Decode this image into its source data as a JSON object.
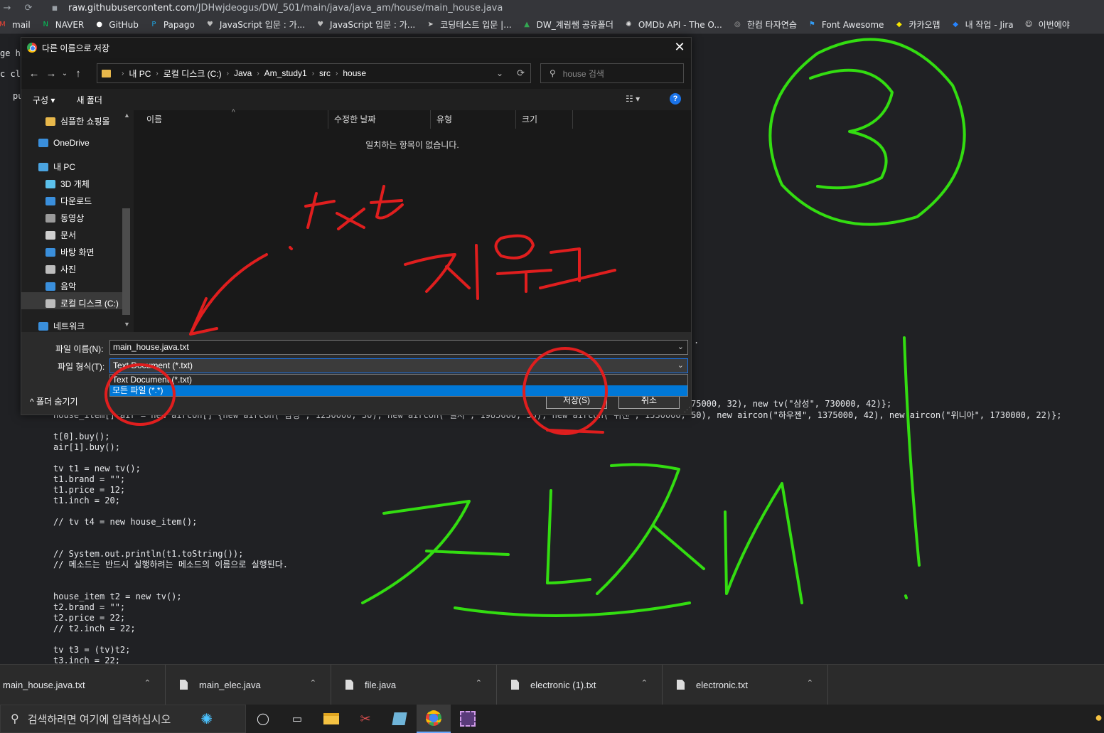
{
  "browser": {
    "url_host": "raw.githubusercontent.com",
    "url_path": "/JDHwjdeogus/DW_501/main/java/java_am/house/main_house.java",
    "bookmarks": [
      {
        "label": "mail",
        "icon": "gmail-icon",
        "color": "#ea4335"
      },
      {
        "label": "NAVER",
        "icon": "naver-icon",
        "color": "#03c75a"
      },
      {
        "label": "GitHub",
        "icon": "github-icon",
        "color": "#ffffff"
      },
      {
        "label": "Papago",
        "icon": "papago-icon",
        "color": "#1fa4e0"
      },
      {
        "label": "JavaScript 입문 : 가...",
        "icon": "heart-icon",
        "color": "#bbbbbb"
      },
      {
        "label": "JavaScript 입문 : 가...",
        "icon": "heart-icon",
        "color": "#bbbbbb"
      },
      {
        "label": "코딩테스트 입문 |...",
        "icon": "arrow-icon",
        "color": "#cccccc"
      },
      {
        "label": "DW_계림쌤 공유폴더",
        "icon": "drive-icon",
        "color": "#34a853"
      },
      {
        "label": "OMDb API - The O...",
        "icon": "omdb-icon",
        "color": "#dddddd"
      },
      {
        "label": "한컴 타자연습",
        "icon": "hancom-icon",
        "color": "#aaaaaa"
      },
      {
        "label": "Font Awesome",
        "icon": "flag-icon",
        "color": "#339af0"
      },
      {
        "label": "카카오맵",
        "icon": "kakaomap-icon",
        "color": "#f7e600"
      },
      {
        "label": "내 작업 - Jira",
        "icon": "jira-icon",
        "color": "#2684ff"
      },
      {
        "label": "이번에야",
        "icon": "avatar-icon",
        "color": "#eeeeee"
      }
    ]
  },
  "page": {
    "left_fragments": [
      "ge ho",
      "c cla",
      "pu"
    ],
    "right_fragments": [
      ".",
      "75000, 32), new tv(\"삼성\", 730000, 42)};"
    ],
    "aircon_line": "house_item[] air = new aircon[] {new aircon(\"삼성\", 1230000, 30), new aircon(\"엘지\", 1985000, 55), new aircon(\"위센\", 1530000, 50), new aircon(\"하우젠\", 1375000, 42), new aircon(\"위니아\", 1730000, 22)};",
    "code_lines": [
      "t[0].buy();",
      "air[1].buy();",
      "",
      "tv t1 = new tv();",
      "t1.brand = \"\";",
      "t1.price = 12;",
      "t1.inch = 20;",
      "",
      "// tv t4 = new house_item();",
      "",
      "",
      "// System.out.println(t1.toString());",
      "// 메소드는 반드시 실행하려는 메소드의 이름으로 실행된다.",
      "",
      "",
      "house_item t2 = new tv();",
      "t2.brand = \"\";",
      "t2.price = 22;",
      "// t2.inch = 22;",
      "",
      "tv t3 = (tv)t2;",
      "t3.inch = 22;"
    ]
  },
  "dialog": {
    "title": "다른 이름으로 저장",
    "breadcrumb": [
      "내 PC",
      "로컬 디스크 (C:)",
      "Java",
      "Am_study1",
      "src",
      "house"
    ],
    "search_placeholder": "house 검색",
    "toolbar": {
      "organize": "구성 ▾",
      "new_folder": "새 폴더",
      "help": "?"
    },
    "sidebar": [
      {
        "label": "심플한 쇼핑몰",
        "icon": "folder-icon",
        "color": "#e8b84b"
      },
      {
        "label": "OneDrive",
        "icon": "onedrive-icon",
        "color": "#3a8fdc"
      },
      {
        "label": "내 PC",
        "icon": "pc-icon",
        "color": "#4aa3df"
      },
      {
        "label": "3D 개체",
        "icon": "cube-icon",
        "color": "#5bc0eb"
      },
      {
        "label": "다운로드",
        "icon": "download-icon",
        "color": "#3a8fdc"
      },
      {
        "label": "동영상",
        "icon": "video-icon",
        "color": "#9a9a9a"
      },
      {
        "label": "문서",
        "icon": "document-icon",
        "color": "#cfcfcf"
      },
      {
        "label": "바탕 화면",
        "icon": "desktop-icon",
        "color": "#3a8fdc"
      },
      {
        "label": "사진",
        "icon": "picture-icon",
        "color": "#bdbdbd"
      },
      {
        "label": "음악",
        "icon": "music-icon",
        "color": "#3a8fdc"
      },
      {
        "label": "로컬 디스크 (C:)",
        "icon": "drive-icon",
        "color": "#bdbdbd"
      },
      {
        "label": "네트워크",
        "icon": "network-icon",
        "color": "#3a8fdc"
      }
    ],
    "columns": [
      "이름",
      "수정한 날짜",
      "유형",
      "크기"
    ],
    "empty_message": "일치하는 항목이 없습니다.",
    "filename_label": "파일 이름(N):",
    "filename_value": "main_house.java.txt",
    "filetype_label": "파일 형식(T):",
    "filetype_value": "Text Document (*.txt)",
    "filetype_options": [
      "Text Document (*.txt)",
      "모든 파일 (*.*)"
    ],
    "hide_folders": "폴더 숨기기",
    "save_button": "저장(S)",
    "cancel_button": "취소"
  },
  "downloads": [
    "main_house.java.txt",
    "main_elec.java",
    "file.java",
    "electronic (1).txt",
    "electronic.txt"
  ],
  "taskbar": {
    "search_placeholder": "검색하려면 여기에 입력하십시오"
  },
  "annotations": {
    "red_text_1": "txt",
    "red_text_2": "지우고",
    "green_text": "저장!",
    "green_number": "③",
    "red_color": "#e01e1e",
    "green_color": "#33dd11"
  }
}
